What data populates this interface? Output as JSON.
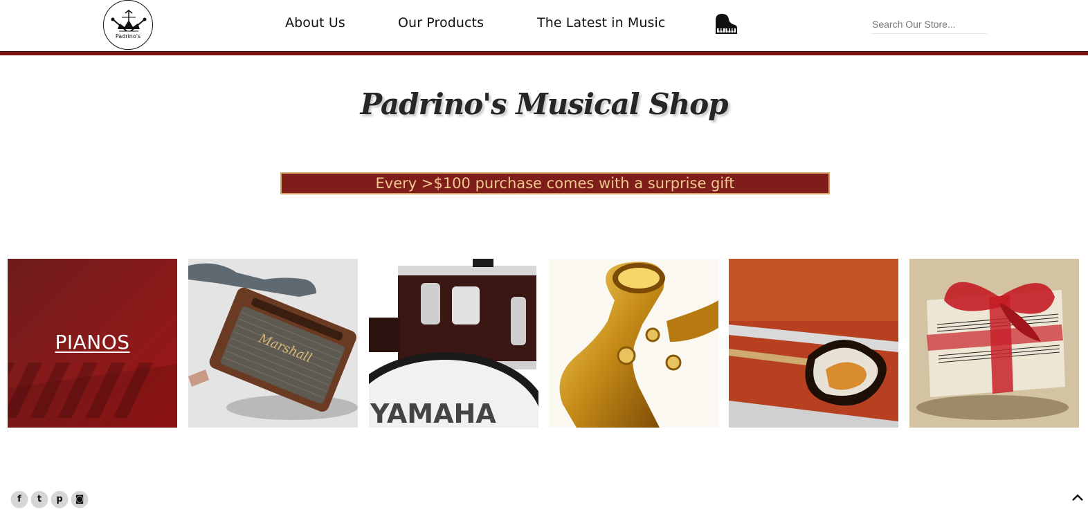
{
  "header": {
    "logo_text": "Padrino's",
    "nav": [
      {
        "label": "About Us"
      },
      {
        "label": "Our Products"
      },
      {
        "label": "The Latest in Music"
      }
    ],
    "piano_icon": "grand-piano-icon",
    "search": {
      "placeholder": "Search Our Store...",
      "value": ""
    }
  },
  "hero": {
    "title": "Padrino's Musical Shop",
    "promo": "Every >$100 purchase comes with a surprise gift"
  },
  "tiles": [
    {
      "label": "PIANOS",
      "image": "piano-keys-image"
    },
    {
      "label": "",
      "image": "marshall-speaker-image"
    },
    {
      "label": "",
      "image": "yamaha-drums-image"
    },
    {
      "label": "",
      "image": "saxophone-image"
    },
    {
      "label": "",
      "image": "electric-guitar-in-case-image"
    },
    {
      "label": "",
      "image": "gift-box-image"
    }
  ],
  "footer": {
    "social": [
      {
        "glyph": "f",
        "icon": "facebook-icon"
      },
      {
        "glyph": "t",
        "icon": "twitter-icon"
      },
      {
        "glyph": "p",
        "icon": "pinterest-icon"
      },
      {
        "glyph": "◙",
        "icon": "instagram-icon"
      }
    ],
    "to_top_icon": "chevron-up-icon"
  },
  "colors": {
    "header_rule": "#7a1212",
    "promo_bg": "#7f1d1a",
    "promo_border": "#d9a46a",
    "promo_text": "#f0c98f",
    "title_text": "#262626"
  }
}
